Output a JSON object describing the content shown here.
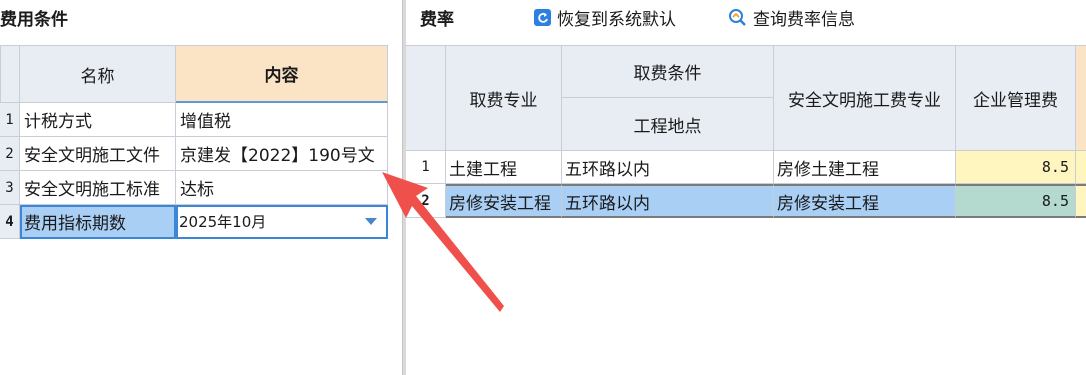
{
  "left_panel": {
    "title": "费用条件",
    "headers": {
      "name": "名称",
      "content": "内容"
    },
    "rows": [
      {
        "num": "1",
        "name": "计税方式",
        "value": "增值税"
      },
      {
        "num": "2",
        "name": "安全文明施工文件",
        "value": "京建发【2022】190号文"
      },
      {
        "num": "3",
        "name": "安全文明施工标准",
        "value": "达标"
      },
      {
        "num": "4",
        "name": "费用指标期数",
        "value": "2025年10月"
      }
    ]
  },
  "right_panel": {
    "title": "费率",
    "toolbar": {
      "restore_label": "恢复到系统默认",
      "query_label": "查询费率信息"
    },
    "headers": {
      "major": "取费专业",
      "condition": "取费条件",
      "location": "工程地点",
      "safety_major": "安全文明施工费专业",
      "mgmt_fee": "企业管理费"
    },
    "rows": [
      {
        "num": "1",
        "major": "土建工程",
        "location": "五环路以内",
        "safety_major": "房修土建工程",
        "mgmt_fee": "8.5"
      },
      {
        "num": "2",
        "major": "房修安装工程",
        "location": "五环路以内",
        "safety_major": "房修安装工程",
        "mgmt_fee": "8.5"
      }
    ]
  },
  "colors": {
    "header_bg": "#e8edf4",
    "active_header_bg": "#fbe3c6",
    "selected_row_bg": "#a9cff5",
    "highlight_cell_bg": "#fff6bf",
    "selected_fee_bg": "#b4d9cf",
    "annotation_arrow": "#f0504b"
  }
}
